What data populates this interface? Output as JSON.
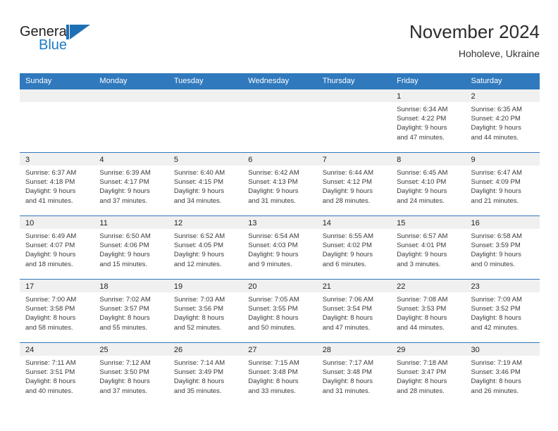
{
  "brand": {
    "name_part1": "General",
    "name_part2": "Blue",
    "mark": "triangle-logo"
  },
  "header": {
    "title": "November 2024",
    "subtitle": "Hoholeve, Ukraine"
  },
  "weekdays": [
    "Sunday",
    "Monday",
    "Tuesday",
    "Wednesday",
    "Thursday",
    "Friday",
    "Saturday"
  ],
  "colors": {
    "header_blue": "#3079bd",
    "brand_blue": "#1d7cc4",
    "day_band_gray": "#f0f0f0",
    "text": "#3a3a3a"
  },
  "weeks": [
    [
      {
        "day": "",
        "sunrise": "",
        "sunset": "",
        "daylight1": "",
        "daylight2": "",
        "empty": true
      },
      {
        "day": "",
        "sunrise": "",
        "sunset": "",
        "daylight1": "",
        "daylight2": "",
        "empty": true
      },
      {
        "day": "",
        "sunrise": "",
        "sunset": "",
        "daylight1": "",
        "daylight2": "",
        "empty": true
      },
      {
        "day": "",
        "sunrise": "",
        "sunset": "",
        "daylight1": "",
        "daylight2": "",
        "empty": true
      },
      {
        "day": "",
        "sunrise": "",
        "sunset": "",
        "daylight1": "",
        "daylight2": "",
        "empty": true
      },
      {
        "day": "1",
        "sunrise": "Sunrise: 6:34 AM",
        "sunset": "Sunset: 4:22 PM",
        "daylight1": "Daylight: 9 hours",
        "daylight2": "and 47 minutes.",
        "empty": false
      },
      {
        "day": "2",
        "sunrise": "Sunrise: 6:35 AM",
        "sunset": "Sunset: 4:20 PM",
        "daylight1": "Daylight: 9 hours",
        "daylight2": "and 44 minutes.",
        "empty": false
      }
    ],
    [
      {
        "day": "3",
        "sunrise": "Sunrise: 6:37 AM",
        "sunset": "Sunset: 4:18 PM",
        "daylight1": "Daylight: 9 hours",
        "daylight2": "and 41 minutes.",
        "empty": false
      },
      {
        "day": "4",
        "sunrise": "Sunrise: 6:39 AM",
        "sunset": "Sunset: 4:17 PM",
        "daylight1": "Daylight: 9 hours",
        "daylight2": "and 37 minutes.",
        "empty": false
      },
      {
        "day": "5",
        "sunrise": "Sunrise: 6:40 AM",
        "sunset": "Sunset: 4:15 PM",
        "daylight1": "Daylight: 9 hours",
        "daylight2": "and 34 minutes.",
        "empty": false
      },
      {
        "day": "6",
        "sunrise": "Sunrise: 6:42 AM",
        "sunset": "Sunset: 4:13 PM",
        "daylight1": "Daylight: 9 hours",
        "daylight2": "and 31 minutes.",
        "empty": false
      },
      {
        "day": "7",
        "sunrise": "Sunrise: 6:44 AM",
        "sunset": "Sunset: 4:12 PM",
        "daylight1": "Daylight: 9 hours",
        "daylight2": "and 28 minutes.",
        "empty": false
      },
      {
        "day": "8",
        "sunrise": "Sunrise: 6:45 AM",
        "sunset": "Sunset: 4:10 PM",
        "daylight1": "Daylight: 9 hours",
        "daylight2": "and 24 minutes.",
        "empty": false
      },
      {
        "day": "9",
        "sunrise": "Sunrise: 6:47 AM",
        "sunset": "Sunset: 4:09 PM",
        "daylight1": "Daylight: 9 hours",
        "daylight2": "and 21 minutes.",
        "empty": false
      }
    ],
    [
      {
        "day": "10",
        "sunrise": "Sunrise: 6:49 AM",
        "sunset": "Sunset: 4:07 PM",
        "daylight1": "Daylight: 9 hours",
        "daylight2": "and 18 minutes.",
        "empty": false
      },
      {
        "day": "11",
        "sunrise": "Sunrise: 6:50 AM",
        "sunset": "Sunset: 4:06 PM",
        "daylight1": "Daylight: 9 hours",
        "daylight2": "and 15 minutes.",
        "empty": false
      },
      {
        "day": "12",
        "sunrise": "Sunrise: 6:52 AM",
        "sunset": "Sunset: 4:05 PM",
        "daylight1": "Daylight: 9 hours",
        "daylight2": "and 12 minutes.",
        "empty": false
      },
      {
        "day": "13",
        "sunrise": "Sunrise: 6:54 AM",
        "sunset": "Sunset: 4:03 PM",
        "daylight1": "Daylight: 9 hours",
        "daylight2": "and 9 minutes.",
        "empty": false
      },
      {
        "day": "14",
        "sunrise": "Sunrise: 6:55 AM",
        "sunset": "Sunset: 4:02 PM",
        "daylight1": "Daylight: 9 hours",
        "daylight2": "and 6 minutes.",
        "empty": false
      },
      {
        "day": "15",
        "sunrise": "Sunrise: 6:57 AM",
        "sunset": "Sunset: 4:01 PM",
        "daylight1": "Daylight: 9 hours",
        "daylight2": "and 3 minutes.",
        "empty": false
      },
      {
        "day": "16",
        "sunrise": "Sunrise: 6:58 AM",
        "sunset": "Sunset: 3:59 PM",
        "daylight1": "Daylight: 9 hours",
        "daylight2": "and 0 minutes.",
        "empty": false
      }
    ],
    [
      {
        "day": "17",
        "sunrise": "Sunrise: 7:00 AM",
        "sunset": "Sunset: 3:58 PM",
        "daylight1": "Daylight: 8 hours",
        "daylight2": "and 58 minutes.",
        "empty": false
      },
      {
        "day": "18",
        "sunrise": "Sunrise: 7:02 AM",
        "sunset": "Sunset: 3:57 PM",
        "daylight1": "Daylight: 8 hours",
        "daylight2": "and 55 minutes.",
        "empty": false
      },
      {
        "day": "19",
        "sunrise": "Sunrise: 7:03 AM",
        "sunset": "Sunset: 3:56 PM",
        "daylight1": "Daylight: 8 hours",
        "daylight2": "and 52 minutes.",
        "empty": false
      },
      {
        "day": "20",
        "sunrise": "Sunrise: 7:05 AM",
        "sunset": "Sunset: 3:55 PM",
        "daylight1": "Daylight: 8 hours",
        "daylight2": "and 50 minutes.",
        "empty": false
      },
      {
        "day": "21",
        "sunrise": "Sunrise: 7:06 AM",
        "sunset": "Sunset: 3:54 PM",
        "daylight1": "Daylight: 8 hours",
        "daylight2": "and 47 minutes.",
        "empty": false
      },
      {
        "day": "22",
        "sunrise": "Sunrise: 7:08 AM",
        "sunset": "Sunset: 3:53 PM",
        "daylight1": "Daylight: 8 hours",
        "daylight2": "and 44 minutes.",
        "empty": false
      },
      {
        "day": "23",
        "sunrise": "Sunrise: 7:09 AM",
        "sunset": "Sunset: 3:52 PM",
        "daylight1": "Daylight: 8 hours",
        "daylight2": "and 42 minutes.",
        "empty": false
      }
    ],
    [
      {
        "day": "24",
        "sunrise": "Sunrise: 7:11 AM",
        "sunset": "Sunset: 3:51 PM",
        "daylight1": "Daylight: 8 hours",
        "daylight2": "and 40 minutes.",
        "empty": false
      },
      {
        "day": "25",
        "sunrise": "Sunrise: 7:12 AM",
        "sunset": "Sunset: 3:50 PM",
        "daylight1": "Daylight: 8 hours",
        "daylight2": "and 37 minutes.",
        "empty": false
      },
      {
        "day": "26",
        "sunrise": "Sunrise: 7:14 AM",
        "sunset": "Sunset: 3:49 PM",
        "daylight1": "Daylight: 8 hours",
        "daylight2": "and 35 minutes.",
        "empty": false
      },
      {
        "day": "27",
        "sunrise": "Sunrise: 7:15 AM",
        "sunset": "Sunset: 3:48 PM",
        "daylight1": "Daylight: 8 hours",
        "daylight2": "and 33 minutes.",
        "empty": false
      },
      {
        "day": "28",
        "sunrise": "Sunrise: 7:17 AM",
        "sunset": "Sunset: 3:48 PM",
        "daylight1": "Daylight: 8 hours",
        "daylight2": "and 31 minutes.",
        "empty": false
      },
      {
        "day": "29",
        "sunrise": "Sunrise: 7:18 AM",
        "sunset": "Sunset: 3:47 PM",
        "daylight1": "Daylight: 8 hours",
        "daylight2": "and 28 minutes.",
        "empty": false
      },
      {
        "day": "30",
        "sunrise": "Sunrise: 7:19 AM",
        "sunset": "Sunset: 3:46 PM",
        "daylight1": "Daylight: 8 hours",
        "daylight2": "and 26 minutes.",
        "empty": false
      }
    ]
  ]
}
